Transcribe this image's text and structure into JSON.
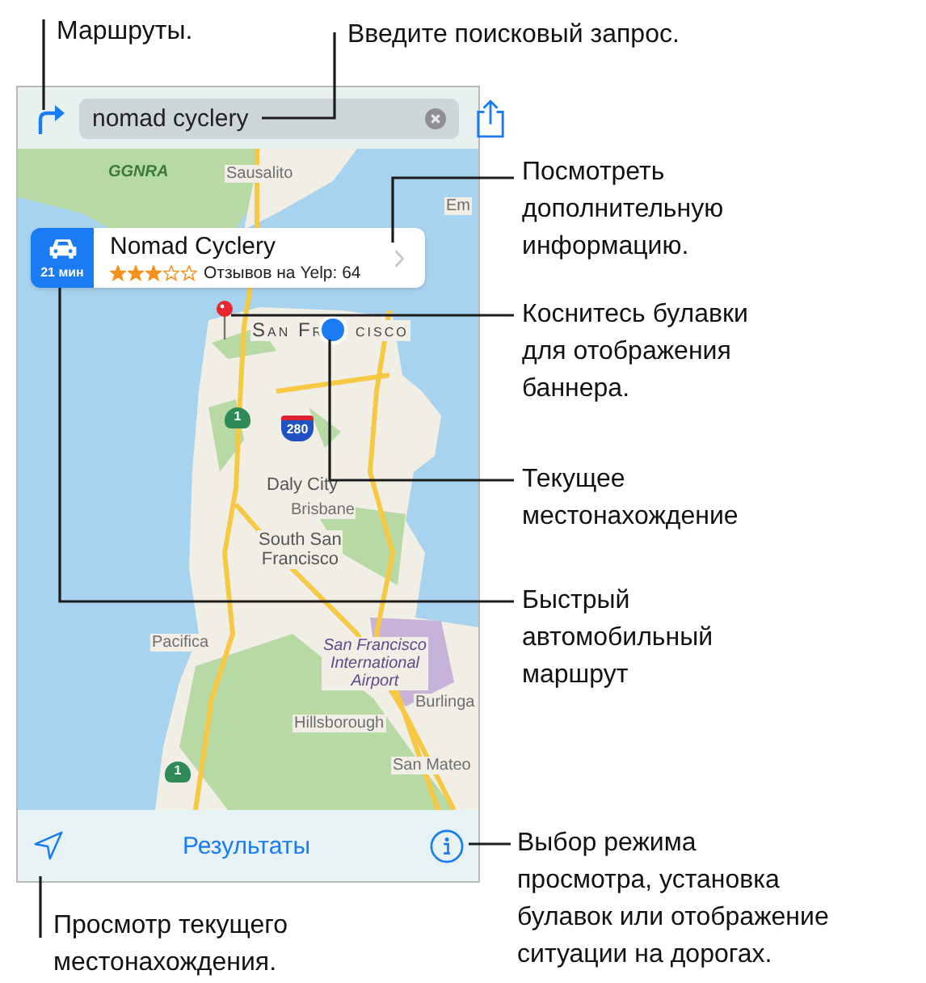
{
  "callouts": [
    {
      "text": "Маршруты."
    },
    {
      "text": "Введите поисковый запрос."
    },
    {
      "text": "Посмотреть\nдополнительную\nинформацию."
    },
    {
      "text": "Коснитесь булавки\nдля отображения\nбаннера."
    },
    {
      "text": "Текущее\nместонахождение"
    },
    {
      "text": "Быстрый\nавтомобильный\nмаршрут"
    },
    {
      "text": "Просмотр текущего\nместонахождения."
    },
    {
      "text": "Выбор режима\nпросмотра, установка\nбулавок или отображение\nситуации на дорогах."
    }
  ],
  "toolbar": {
    "search": {
      "value": "nomad cyclery"
    }
  },
  "map": {
    "labels": [
      {
        "text": "GGNRA",
        "kind": "park"
      },
      {
        "text": "Sausalito",
        "kind": "town"
      },
      {
        "text": "Em",
        "kind": "town"
      },
      {
        "text": "San Fr",
        "kind": "city"
      },
      {
        "text": "cisco",
        "kind": "city"
      },
      {
        "text": "Daly City",
        "kind": "major"
      },
      {
        "text": "Brisbane",
        "kind": "town"
      },
      {
        "text": "South San\nFrancisco",
        "kind": "major"
      },
      {
        "text": "Pacifica",
        "kind": "town"
      },
      {
        "text": "San Francisco\nInternational\nAirport",
        "kind": "airport"
      },
      {
        "text": "Burlinga",
        "kind": "town"
      },
      {
        "text": "Hillsborough",
        "kind": "town"
      },
      {
        "text": "San Mateo",
        "kind": "town"
      }
    ],
    "shields": [
      {
        "text": "1",
        "kind": "state"
      },
      {
        "text": "280",
        "kind": "interstate"
      },
      {
        "text": "1",
        "kind": "state"
      }
    ]
  },
  "banner": {
    "drive_time": "21 мин",
    "title": "Nomad Cyclery",
    "stars": 3,
    "reviews": "Отзывов на Yelp: 64"
  },
  "bottom_bar": {
    "results": "Результаты"
  }
}
